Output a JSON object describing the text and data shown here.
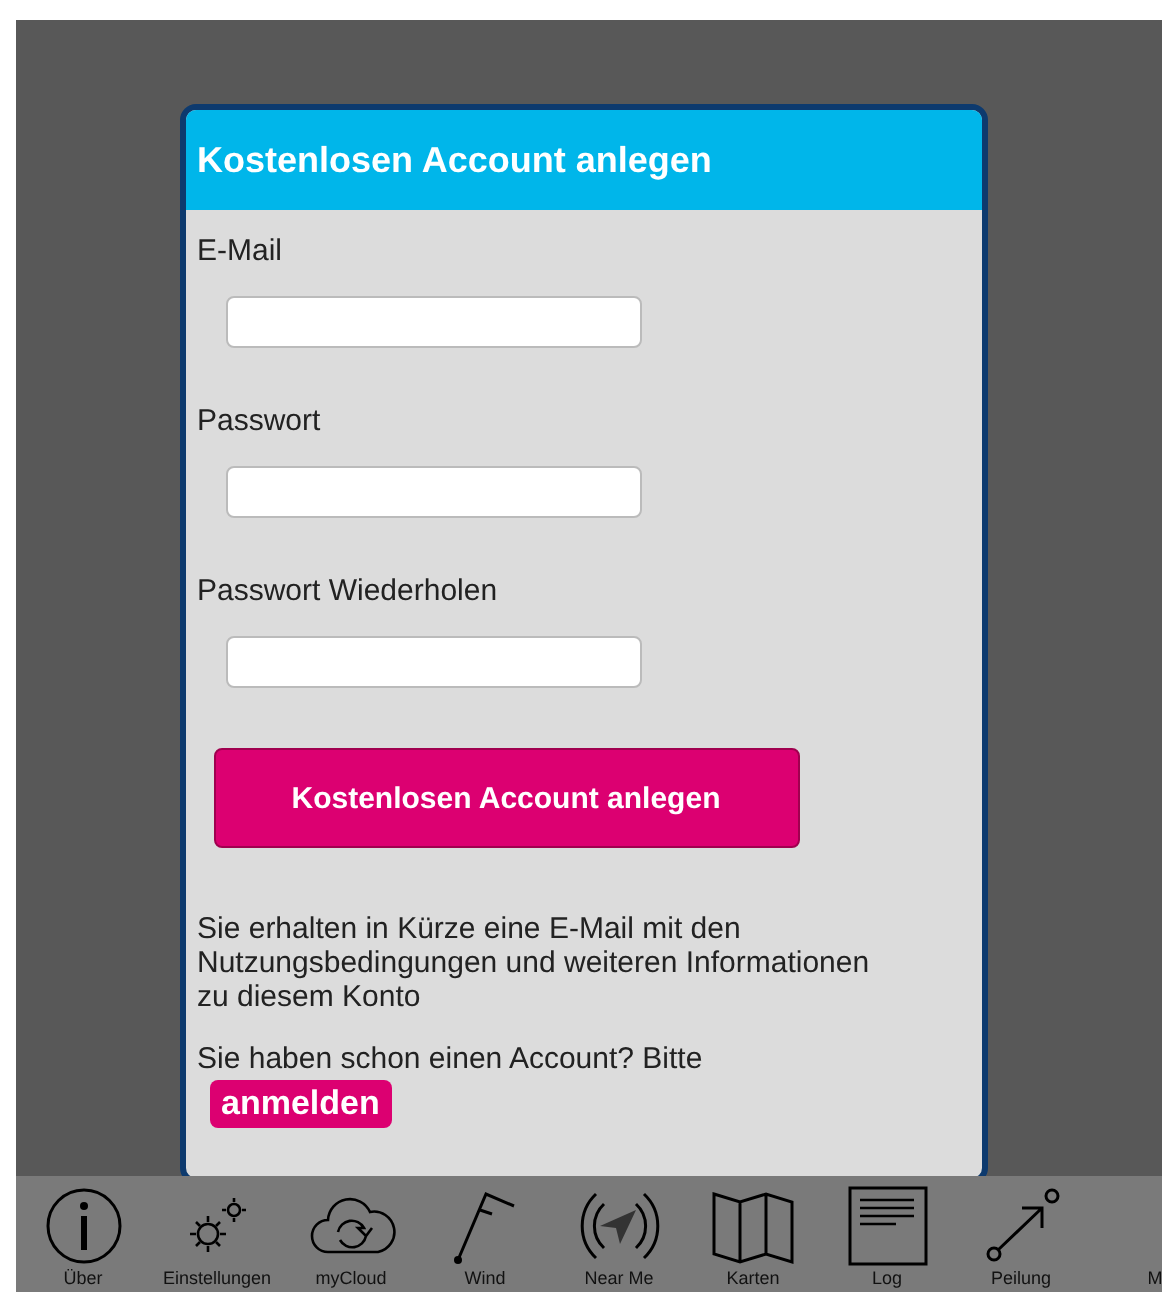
{
  "dialog": {
    "title": "Kostenlosen Account anlegen",
    "fields": [
      {
        "label": "E-Mail"
      },
      {
        "label": "Passwort"
      },
      {
        "label": "Passwort Wiederholen"
      }
    ],
    "submit_button": "Kostenlosen Account anlegen",
    "info_text": "Sie erhalten in Kürze eine E-Mail mit den Nutzungsbedingungen und weiteren Informationen zu diesem Konto",
    "login_prompt": "Sie haben schon einen Account? Bitte",
    "login_button": "anmelden"
  },
  "toolbar": [
    {
      "kind": "info",
      "label": "Über"
    },
    {
      "kind": "gears",
      "label": "Einstellungen"
    },
    {
      "kind": "cloud",
      "label": "myCloud"
    },
    {
      "kind": "wind",
      "label": "Wind"
    },
    {
      "kind": "nearme",
      "label": "Near Me"
    },
    {
      "kind": "map",
      "label": "Karten"
    },
    {
      "kind": "log",
      "label": "Log"
    },
    {
      "kind": "bearing",
      "label": "Peilung"
    },
    {
      "kind": "none",
      "label": "M"
    }
  ]
}
